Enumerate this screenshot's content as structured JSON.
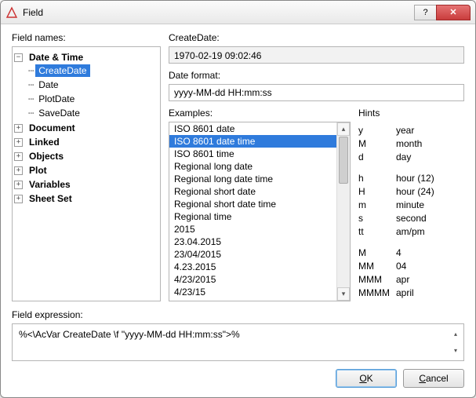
{
  "window": {
    "title": "Field"
  },
  "labels": {
    "fieldNames": "Field names:",
    "createDate": "CreateDate:",
    "dateFormat": "Date format:",
    "examples": "Examples:",
    "hints": "Hints",
    "fieldExpression": "Field expression:"
  },
  "tree": {
    "root": [
      {
        "label": "Date & Time",
        "expanded": true,
        "children": [
          {
            "label": "CreateDate",
            "selected": true
          },
          {
            "label": "Date"
          },
          {
            "label": "PlotDate"
          },
          {
            "label": "SaveDate"
          }
        ]
      },
      {
        "label": "Document",
        "expanded": false
      },
      {
        "label": "Linked",
        "expanded": false
      },
      {
        "label": "Objects",
        "expanded": false
      },
      {
        "label": "Plot",
        "expanded": false
      },
      {
        "label": "Variables",
        "expanded": false
      },
      {
        "label": "Sheet Set",
        "expanded": false
      }
    ]
  },
  "createDateValue": "1970-02-19 09:02:46",
  "dateFormatValue": "yyyy-MM-dd HH:mm:ss",
  "examples": [
    "ISO 8601 date",
    "ISO 8601 date time",
    "ISO 8601 time",
    "Regional long date",
    "Regional long date time",
    "Regional short date",
    "Regional short date time",
    "Regional time",
    "2015",
    "23.04.2015",
    "23/04/2015",
    "4.23.2015",
    "4/23/2015",
    "4/23/15"
  ],
  "examplesSelectedIndex": 1,
  "hints": [
    {
      "k": "y",
      "v": "year"
    },
    {
      "k": "M",
      "v": "month"
    },
    {
      "k": "d",
      "v": "day"
    },
    {
      "gap": true
    },
    {
      "k": "h",
      "v": "hour (12)"
    },
    {
      "k": "H",
      "v": "hour (24)"
    },
    {
      "k": "m",
      "v": "minute"
    },
    {
      "k": "s",
      "v": "second"
    },
    {
      "k": "tt",
      "v": "am/pm"
    },
    {
      "gap": true
    },
    {
      "k": "M",
      "v": "4"
    },
    {
      "k": "MM",
      "v": "04"
    },
    {
      "k": "MMM",
      "v": "apr"
    },
    {
      "k": "MMMM",
      "v": "april"
    }
  ],
  "fieldExpression": "%<\\AcVar CreateDate \\f \"yyyy-MM-dd HH:mm:ss\">%",
  "buttons": {
    "ok": "OK",
    "cancel": "Cancel"
  }
}
